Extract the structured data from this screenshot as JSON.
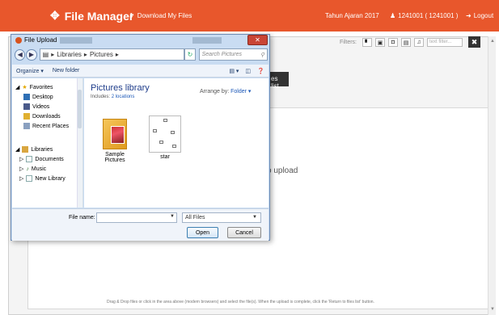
{
  "topbar": {
    "brand": "File Manager",
    "download_label": "Download My Files",
    "tahun": "Tahun Ajaran 2017",
    "user": "1241001 ( 1241001 )",
    "logout": "Logout"
  },
  "app": {
    "filters_label": "Filters:",
    "filter_placeholder": "text filter...",
    "tooltip_text": "es list",
    "drop_hint": "o upload",
    "footer_hint": "Drag & Drop files or click in the area above (modern browsers) and select the file(s). When the upload is complete, click the 'Return to files list' button."
  },
  "dialog": {
    "title": "File Upload",
    "address": {
      "crumb1": "Libraries",
      "crumb2": "Pictures"
    },
    "search_placeholder": "Search Pictures",
    "toolbar": {
      "organize": "Organize",
      "new_folder": "New folder"
    },
    "nav": {
      "favorites": "Favorites",
      "desktop": "Desktop",
      "videos": "Videos",
      "downloads": "Downloads",
      "recent_places": "Recent Places",
      "libraries": "Libraries",
      "documents": "Documents",
      "music": "Music",
      "new_library": "New Library"
    },
    "library_title": "Pictures library",
    "includes_prefix": "Includes:",
    "includes_link": "2 locations",
    "arrange_label": "Arrange by:",
    "arrange_value": "Folder",
    "items": [
      {
        "name": "Sample Pictures"
      },
      {
        "name": "star"
      }
    ],
    "file_name_label": "File name:",
    "file_type": "All Files",
    "open_label": "Open",
    "cancel_label": "Cancel"
  }
}
